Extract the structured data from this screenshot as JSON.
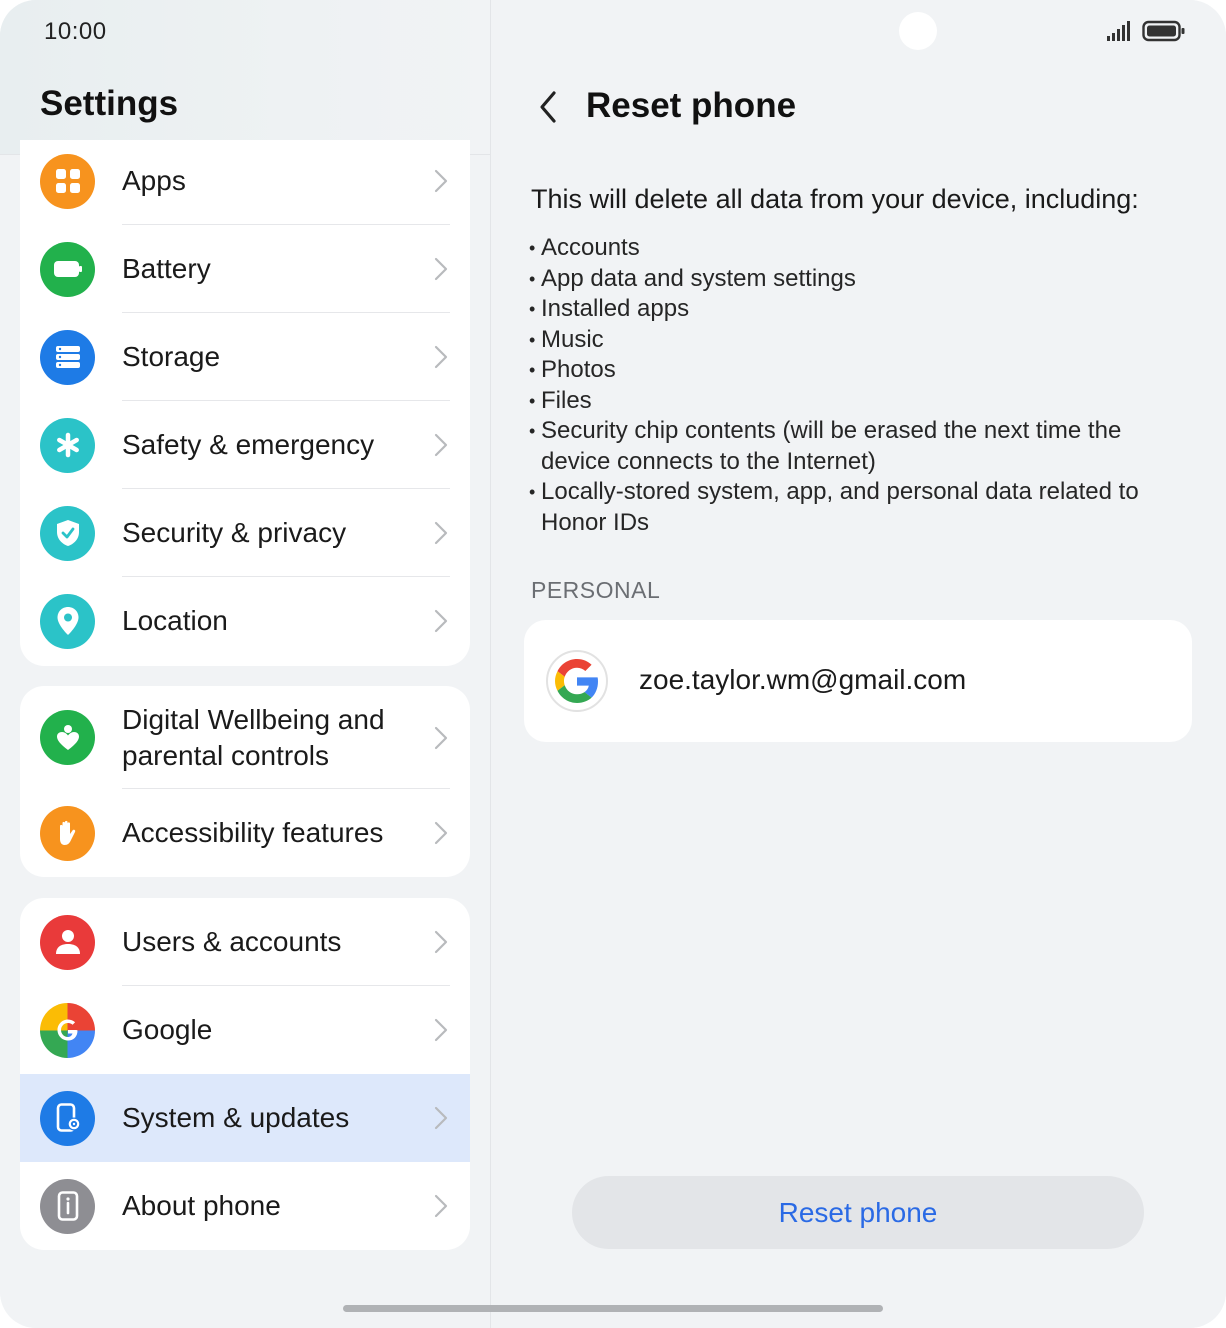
{
  "status_bar": {
    "time": "10:00"
  },
  "left": {
    "title": "Settings",
    "groups": [
      {
        "items": [
          {
            "key": "apps",
            "label": "Apps",
            "color": "#f7931e",
            "icon": "apps-grid-icon"
          },
          {
            "key": "battery",
            "label": "Battery",
            "color": "#22b14c",
            "icon": "battery-icon"
          },
          {
            "key": "storage",
            "label": "Storage",
            "color": "#1e7be6",
            "icon": "storage-icon"
          },
          {
            "key": "safety",
            "label": "Safety & emergency",
            "color": "#2bc3c8",
            "icon": "asterisk-icon"
          },
          {
            "key": "security",
            "label": "Security & privacy",
            "color": "#2bc3c8",
            "icon": "shield-check-icon"
          },
          {
            "key": "location",
            "label": "Location",
            "color": "#2bc3c8",
            "icon": "location-pin-icon"
          }
        ]
      },
      {
        "items": [
          {
            "key": "wellbeing",
            "label_line1": "Digital Wellbeing and",
            "label_line2": "parental controls",
            "color": "#22b14c",
            "icon": "wellbeing-heart-icon"
          },
          {
            "key": "accessibility",
            "label": "Accessibility features",
            "color": "#f7931e",
            "icon": "hand-icon"
          }
        ]
      },
      {
        "items": [
          {
            "key": "users",
            "label": "Users & accounts",
            "color": "#e93a3a",
            "icon": "person-icon"
          },
          {
            "key": "google",
            "label": "Google",
            "color": "#4285f4",
            "icon": "google-g-icon"
          },
          {
            "key": "system",
            "label": "System & updates",
            "color": "#1e7be6",
            "icon": "phone-gear-icon",
            "selected": true
          },
          {
            "key": "about",
            "label": "About phone",
            "color": "#8e8e93",
            "icon": "phone-info-icon"
          }
        ]
      }
    ]
  },
  "right": {
    "title": "Reset phone",
    "intro": "This will delete all data from your device, including:",
    "bullets": [
      "Accounts",
      "App data and system settings",
      "Installed apps",
      "Music",
      "Photos",
      "Files",
      "Security chip contents (will be erased the next time the device connects to the Internet)",
      "Locally-stored system, app, and personal data related to Honor IDs"
    ],
    "section_label": "PERSONAL",
    "account_email": "zoe.taylor.wm@gmail.com",
    "reset_button_label": "Reset phone",
    "accent_color": "#2a6ae5"
  }
}
